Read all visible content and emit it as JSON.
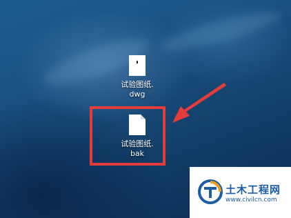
{
  "desktop": {
    "icons": [
      {
        "line1": "试验图纸.",
        "line2": "dwg"
      },
      {
        "line1": "试验图纸.",
        "line2": "bak"
      }
    ]
  },
  "watermark": {
    "title": "土木工程网",
    "url": "www.civilcn.com",
    "colors": {
      "primary": "#1c5da8",
      "accent": "#f0a020"
    }
  },
  "annotation": {
    "color": "#e43b3b"
  }
}
